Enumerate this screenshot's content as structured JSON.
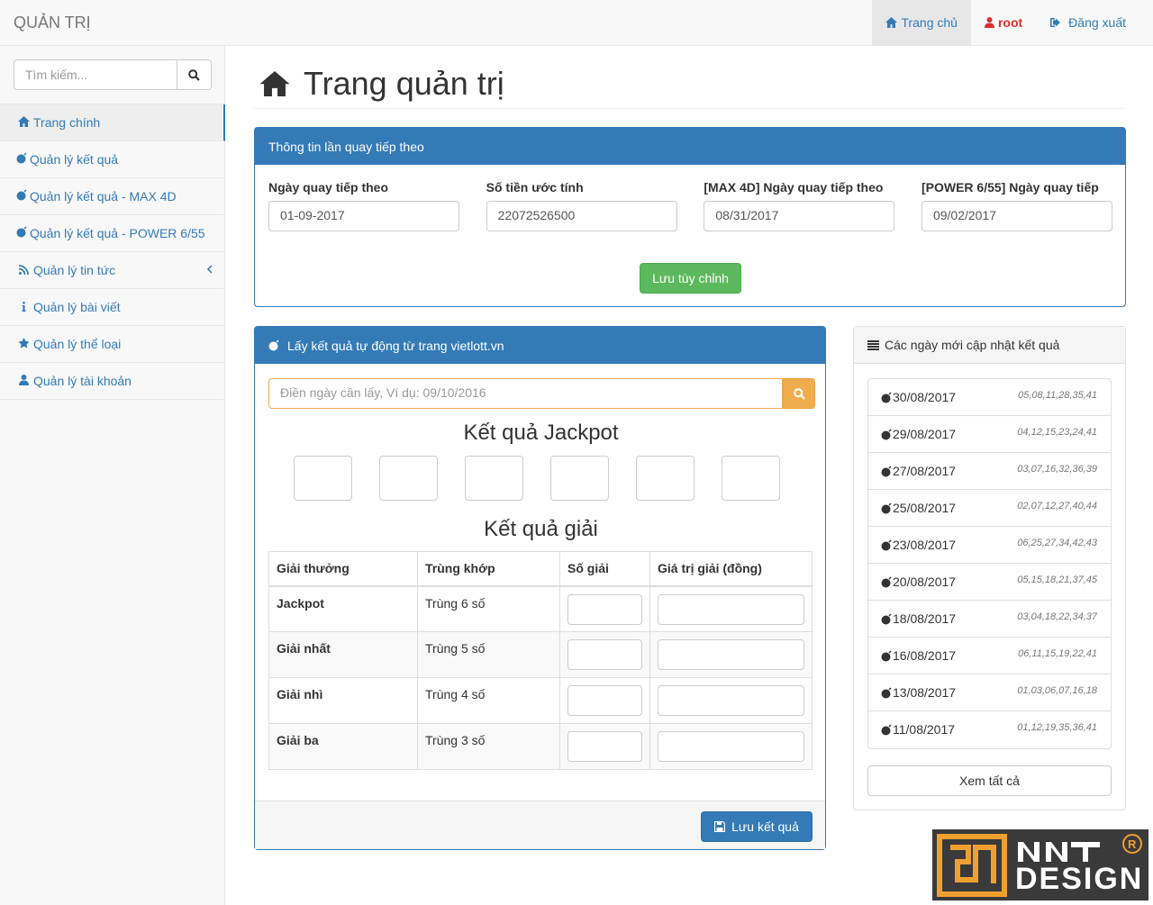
{
  "navbar": {
    "brand": "QUẢN TRỊ",
    "home": "Trang chủ",
    "user": "root",
    "logout": "Đăng xuất"
  },
  "sidebar": {
    "search_placeholder": "Tìm kiếm...",
    "items": [
      {
        "label": "Trang chính",
        "icon": "home-icon"
      },
      {
        "label": "Quản lý kết quả",
        "icon": "bomb-icon"
      },
      {
        "label": "Quản lý kết quả - MAX 4D",
        "icon": "bomb-icon"
      },
      {
        "label": "Quản lý kết quả - POWER 6/55",
        "icon": "bomb-icon"
      },
      {
        "label": "Quản lý tin tức",
        "icon": "rss-icon"
      },
      {
        "label": "Quản lý bài viết",
        "icon": "info-icon"
      },
      {
        "label": "Quản lý thể loại",
        "icon": "star-icon"
      },
      {
        "label": "Quản lý tài khoản",
        "icon": "user-icon"
      }
    ]
  },
  "page": {
    "title": "Trang quản trị"
  },
  "next_draw": {
    "heading": "Thông tin lần quay tiếp theo",
    "fields": [
      {
        "label": "Ngày quay tiếp theo",
        "value": "01-09-2017"
      },
      {
        "label": "Số tiền ước tính",
        "value": "22072526500"
      },
      {
        "label": "[MAX 4D] Ngày quay tiếp theo",
        "value": "08/31/2017"
      },
      {
        "label": "[POWER 6/55] Ngày quay tiếp",
        "value": "09/02/2017"
      }
    ],
    "save_label": "Lưu tùy chỉnh"
  },
  "auto_fetch": {
    "heading": "Lấy kết quả tự động từ trang vietlott.vn",
    "search_placeholder": "Điền ngày cần lấy, Ví dụ: 09/10/2016",
    "jackpot_title": "Kết quả Jackpot",
    "prize_title": "Kết quả giải",
    "columns": [
      "Giải thưởng",
      "Trùng khớp",
      "Số giải",
      "Giá trị giải (đồng)"
    ],
    "rows": [
      {
        "prize": "Jackpot",
        "match": "Trùng 6 số"
      },
      {
        "prize": "Giải nhất",
        "match": "Trùng 5 số"
      },
      {
        "prize": "Giải nhì",
        "match": "Trùng 4 số"
      },
      {
        "prize": "Giải ba",
        "match": "Trùng 3 số"
      }
    ],
    "save_label": "Lưu kết quả"
  },
  "recent": {
    "heading": "Các ngày mới cập nhật kết quả",
    "items": [
      {
        "date": "30/08/2017",
        "numbers": "05,08,11,28,35,41"
      },
      {
        "date": "29/08/2017",
        "numbers": "04,12,15,23,24,41"
      },
      {
        "date": "27/08/2017",
        "numbers": "03,07,16,32,36,39"
      },
      {
        "date": "25/08/2017",
        "numbers": "02,07,12,27,40,44"
      },
      {
        "date": "23/08/2017",
        "numbers": "06,25,27,34,42,43"
      },
      {
        "date": "20/08/2017",
        "numbers": "05,15,18,21,37,45"
      },
      {
        "date": "18/08/2017",
        "numbers": "03,04,18,22,34,37"
      },
      {
        "date": "16/08/2017",
        "numbers": "06,11,15,19,22,41"
      },
      {
        "date": "13/08/2017",
        "numbers": "01,03,06,07,16,18"
      },
      {
        "date": "11/08/2017",
        "numbers": "01,12,19,35,36,41"
      }
    ],
    "view_all": "Xem tất cả"
  },
  "watermark": {
    "text": "NNT DESIGN"
  },
  "colors": {
    "primary": "#337ab7",
    "success": "#5cb85c",
    "warning": "#f0ad4e",
    "danger": "#d9302c"
  }
}
